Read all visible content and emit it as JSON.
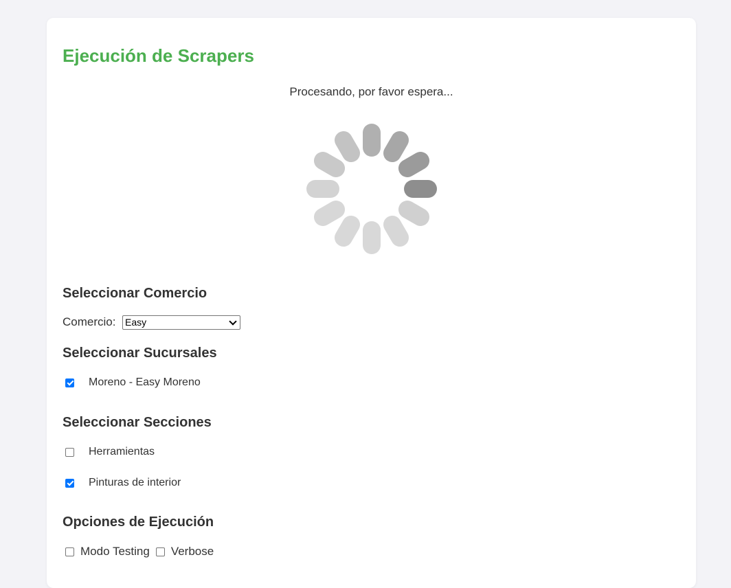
{
  "page": {
    "title": "Ejecución de Scrapers",
    "status_text": "Procesando, por favor espera..."
  },
  "colors": {
    "title": "#4caf50",
    "checkbox_checked": "#0075ff",
    "background": "#f3f3f7"
  },
  "comercio_section": {
    "heading": "Seleccionar Comercio",
    "label": "Comercio:",
    "selected": "Easy"
  },
  "sucursales_section": {
    "heading": "Seleccionar Sucursales",
    "items": [
      {
        "label": "Moreno - Easy Moreno",
        "checked": true
      }
    ]
  },
  "secciones_section": {
    "heading": "Seleccionar Secciones",
    "items": [
      {
        "label": "Herramientas",
        "checked": false
      },
      {
        "label": "Pinturas de interior",
        "checked": true
      }
    ]
  },
  "opciones_section": {
    "heading": "Opciones de Ejecución",
    "items": [
      {
        "label": "Modo Testing",
        "checked": false
      },
      {
        "label": "Verbose",
        "checked": false
      }
    ]
  }
}
